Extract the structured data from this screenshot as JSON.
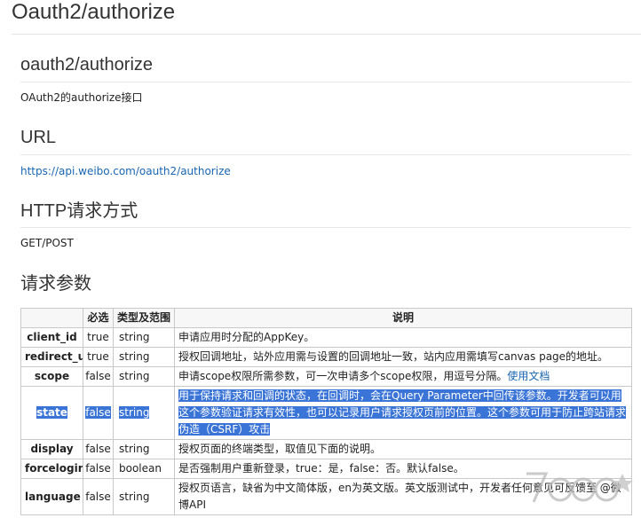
{
  "page_title": "Oauth2/authorize",
  "api_name": {
    "heading": "oauth2/authorize",
    "description": "OAuth2的authorize接口"
  },
  "url_section": {
    "heading": "URL",
    "url": "https://api.weibo.com/oauth2/authorize"
  },
  "http_section": {
    "heading": "HTTP请求方式",
    "method": "GET/POST"
  },
  "params_section": {
    "heading": "请求参数",
    "columns": [
      "",
      "必选",
      "类型及范围",
      "说明"
    ],
    "rows": [
      {
        "name": "client_id",
        "required": "true",
        "type": "string",
        "desc": "申请应用时分配的AppKey。",
        "link": ""
      },
      {
        "name": "redirect_uri",
        "required": "true",
        "type": "string",
        "desc": "授权回调地址，站外应用需与设置的回调地址一致，站内应用需填写canvas page的地址。",
        "link": ""
      },
      {
        "name": "scope",
        "required": "false",
        "type": "string",
        "desc": "申请scope权限所需参数，可一次申请多个scope权限，用逗号分隔。",
        "link": "使用文档"
      },
      {
        "name": "state",
        "required": "false",
        "type": "string",
        "desc": "用于保持请求和回调的状态，在回调时，会在Query Parameter中回传该参数。开发者可以用这个参数验证请求有效性，也可以记录用户请求授权页前的位置。这个参数可用于防止跨站请求伪造（CSRF）攻击",
        "link": ""
      },
      {
        "name": "display",
        "required": "false",
        "type": "string",
        "desc": "授权页面的终端类型，取值见下面的说明。",
        "link": ""
      },
      {
        "name": "forcelogin",
        "required": "false",
        "type": "boolean",
        "desc": "是否强制用户重新登录，true：是，false：否。默认false。",
        "link": ""
      },
      {
        "name": "language",
        "required": "false",
        "type": "string",
        "desc": "授权页语言，缺省为中文简体版，en为英文版。英文版测试中，开发者任何意见可反馈至 @微博API",
        "link": ""
      }
    ]
  },
  "colors": {
    "selection": "#3a74d6",
    "link": "#1a66b3"
  }
}
